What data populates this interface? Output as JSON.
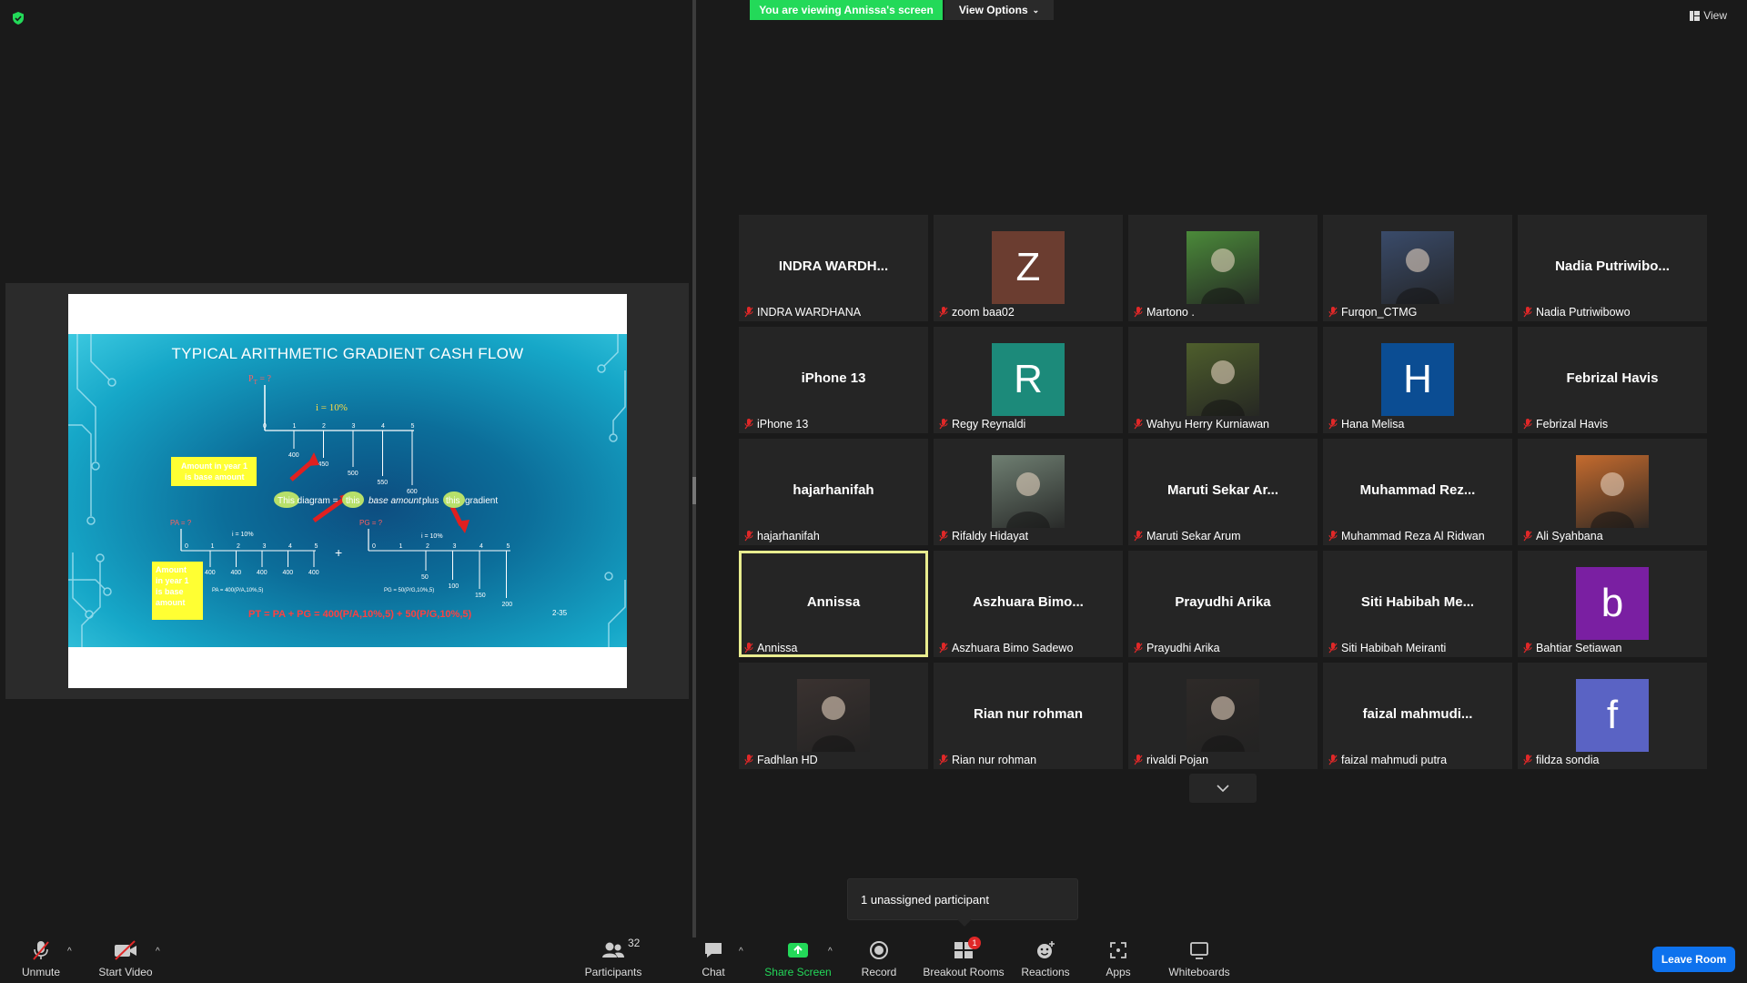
{
  "top": {
    "viewing_banner": "You are viewing Annissa's screen",
    "view_options": "View Options",
    "view": "View"
  },
  "slide": {
    "title": "TYPICAL ARITHMETIC GRADIENT CASH FLOW",
    "pt_label": "P",
    "pt_suffix": "T = ?",
    "interest_main": "i = 10%",
    "interest_small": "i = 10%",
    "callout_top": "Amount in year 1 is base amount",
    "callout_bottom": "Amount in year 1 is base amount",
    "diagram_text_1": "This diagram =",
    "diagram_text_2": "this",
    "diagram_text_3": "base amount",
    "diagram_text_4": "plus",
    "diagram_text_5": "this",
    "diagram_text_6": "gradient",
    "pa_left": "PA = ?",
    "pg_right": "PG = ?",
    "pa_formula": "PA = 400(P/A,10%,5)",
    "pg_formula": "PG = 50(P/G,10%,5)",
    "plus": "+",
    "equation": "PT = PA + PG = 400(P/A,10%,5) + 50(P/G,10%,5)",
    "page": "2-35",
    "top_years": [
      "0",
      "1",
      "2",
      "3",
      "4",
      "5"
    ],
    "top_amounts": [
      "400",
      "450",
      "500",
      "550",
      "600"
    ],
    "left_years": [
      "0",
      "1",
      "2",
      "3",
      "4",
      "5"
    ],
    "left_amounts": [
      "400",
      "400",
      "400",
      "400",
      "400"
    ],
    "right_years": [
      "0",
      "1",
      "2",
      "3",
      "4",
      "5"
    ],
    "right_amounts": [
      "50",
      "100",
      "150",
      "200"
    ]
  },
  "participants": [
    {
      "big": "INDRA  WARDH...",
      "name": "INDRA WARDHANA",
      "kind": "name"
    },
    {
      "big": "Z",
      "name": "zoom baa02",
      "kind": "letter",
      "color": "#6b3d30"
    },
    {
      "big": "",
      "name": "Martono .",
      "kind": "photo",
      "color": "#4b8a3a"
    },
    {
      "big": "",
      "name": "Furqon_CTMG",
      "kind": "photo",
      "color": "#3a4b6a"
    },
    {
      "big": "Nadia  Putriwibo...",
      "name": "Nadia Putriwibowo",
      "kind": "name"
    },
    {
      "big": "iPhone 13",
      "name": "iPhone 13",
      "kind": "name"
    },
    {
      "big": "R",
      "name": "Regy Reynaldi",
      "kind": "letter",
      "color": "#1c8a7a"
    },
    {
      "big": "",
      "name": "Wahyu Herry Kurniawan",
      "kind": "photo",
      "color": "#4e5e2c"
    },
    {
      "big": "H",
      "name": "Hana Melisa",
      "kind": "letter",
      "color": "#0b4d93"
    },
    {
      "big": "Febrizal Havis",
      "name": "Febrizal Havis",
      "kind": "name"
    },
    {
      "big": "hajarhanifah",
      "name": "hajarhanifah",
      "kind": "name"
    },
    {
      "big": "",
      "name": "Rifaldy Hidayat",
      "kind": "photo",
      "color": "#6f7f72"
    },
    {
      "big": "Maruti  Sekar  Ar...",
      "name": "Maruti Sekar Arum",
      "kind": "name"
    },
    {
      "big": "Muhammad  Rez...",
      "name": "Muhammad Reza Al Ridwan",
      "kind": "name"
    },
    {
      "big": "",
      "name": "Ali Syahbana",
      "kind": "photo",
      "color": "#c56b2e"
    },
    {
      "big": "Annissa",
      "name": "Annissa",
      "kind": "name",
      "active": true
    },
    {
      "big": "Aszhuara  Bimo...",
      "name": "Aszhuara Bimo Sadewo",
      "kind": "name"
    },
    {
      "big": "Prayudhi Arika",
      "name": "Prayudhi Arika",
      "kind": "name"
    },
    {
      "big": "Siti  Habibah  Me...",
      "name": "Siti Habibah Meiranti",
      "kind": "name"
    },
    {
      "big": "b",
      "name": "Bahtiar Setiawan",
      "kind": "letter",
      "color": "#7a1fa2"
    },
    {
      "big": "",
      "name": "Fadhlan HD",
      "kind": "photo",
      "color": "#3a3230"
    },
    {
      "big": "Rian nur rohman",
      "name": "Rian nur rohman",
      "kind": "name"
    },
    {
      "big": "",
      "name": "rivaldi Pojan",
      "kind": "photo",
      "color": "#2e2a28"
    },
    {
      "big": "faizal  mahmudi...",
      "name": "faizal mahmudi putra",
      "kind": "name"
    },
    {
      "big": "f",
      "name": "fildza sondia",
      "kind": "letter",
      "color": "#5a63c4"
    }
  ],
  "toast": "1 unassigned participant",
  "toolbar": {
    "unmute": "Unmute",
    "start_video": "Start Video",
    "participants": "Participants",
    "participants_count": "32",
    "chat": "Chat",
    "share_screen": "Share Screen",
    "record": "Record",
    "breakout_rooms": "Breakout Rooms",
    "breakout_badge": "1",
    "reactions": "Reactions",
    "apps": "Apps",
    "whiteboards": "Whiteboards",
    "leave_room": "Leave Room"
  },
  "colors": {
    "banner": "#23d959",
    "active_outline": "#e8ed8f",
    "leave": "#0e72ed",
    "muted": "#e02828"
  }
}
